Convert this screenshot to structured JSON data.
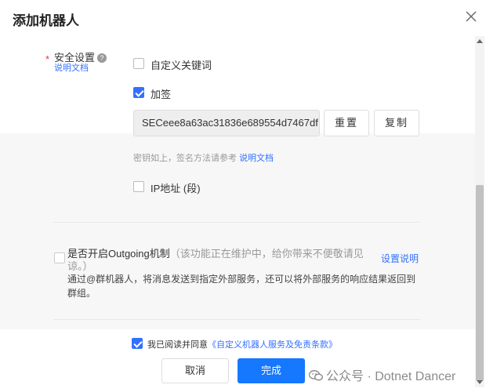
{
  "dialog": {
    "title": "添加机器人"
  },
  "security": {
    "required_mark": "*",
    "label": "安全设置",
    "help_glyph": "?",
    "doc_link": "说明文档",
    "keyword_label": "自定义关键词",
    "sign_label": "加签",
    "secret_value": "SECeee8a63ac31836e689554d7467df:",
    "reset_label": "重置",
    "copy_label": "复制",
    "hint_text": "密钥如上，签名方法请参考",
    "hint_link": "说明文档",
    "ip_label": "IP地址 (段)"
  },
  "outgoing": {
    "title": "是否开启Outgoing机制",
    "note_line1": "（该功能正在维护中，给你带来不便敬请见",
    "note_line2": "谅。）",
    "setup_link": "设置说明",
    "description": "通过@群机器人，将消息发送到指定外部服务，还可以将外部服务的响应结果返回到群组。"
  },
  "agreement": {
    "text": "我已阅读并同意",
    "link": "《自定义机器人服务及免责条款》"
  },
  "footer": {
    "cancel_label": "取消",
    "done_label": "完成"
  },
  "watermark": {
    "text": "公众号 · Dotnet Dancer"
  },
  "icons": [
    "close-icon",
    "help-icon",
    "check-icon",
    "wechat-icon"
  ],
  "colors": {
    "accent": "#3370ff",
    "primary_button": "#1677ff",
    "required": "#e53935"
  }
}
